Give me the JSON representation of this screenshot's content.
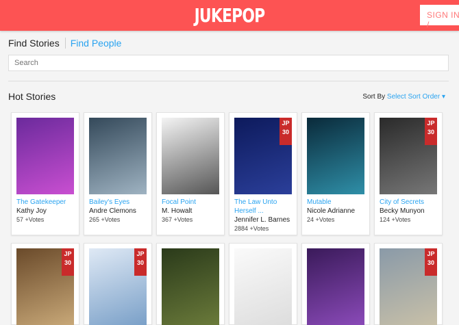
{
  "header": {
    "logo": "JUKEPOP",
    "signin_label": "SIGN IN /"
  },
  "tabs": [
    {
      "label": "Find Stories"
    },
    {
      "label": "Find People"
    }
  ],
  "search": {
    "placeholder": "Search"
  },
  "section": {
    "title": "Hot Stories",
    "sort_label": "Sort By",
    "sort_value": "Select Sort Order"
  },
  "stories": [
    {
      "title": "The Gatekeeper",
      "author": "Kathy Joy",
      "votes": "57 +Votes",
      "badge": "",
      "colors": [
        "#6b2a9c",
        "#c94fd1"
      ]
    },
    {
      "title": "Bailey's Eyes",
      "author": "Andre Clemons",
      "votes": "265 +Votes",
      "badge": "",
      "colors": [
        "#34495a",
        "#9fb3c2"
      ]
    },
    {
      "title": "Focal Point",
      "author": "M. Howalt",
      "votes": "367 +Votes",
      "badge": "",
      "colors": [
        "#f4f4f4",
        "#555"
      ]
    },
    {
      "title": "The Law Unto Herself ...",
      "author": "Jennifer L. Barnes",
      "votes": "2884 +Votes",
      "badge": "JP 30",
      "colors": [
        "#0d1a5c",
        "#2b3f9a"
      ]
    },
    {
      "title": "Mutable",
      "author": "Nicole Adrianne",
      "votes": "24 +Votes",
      "badge": "",
      "colors": [
        "#0a2a3a",
        "#2f8fa8"
      ]
    },
    {
      "title": "City of Secrets",
      "author": "Becky Munyon",
      "votes": "124 +Votes",
      "badge": "JP 30",
      "colors": [
        "#2a2a2a",
        "#777"
      ]
    }
  ],
  "stories_row2": [
    {
      "badge": "JP 30",
      "colors": [
        "#6a4a2a",
        "#c8a878"
      ]
    },
    {
      "badge": "JP 30",
      "colors": [
        "#dfe9f5",
        "#7aa0c8"
      ]
    },
    {
      "badge": "",
      "colors": [
        "#2a3a1a",
        "#6a7a3a"
      ]
    },
    {
      "badge": "",
      "colors": [
        "#fafafa",
        "#ddd"
      ]
    },
    {
      "badge": "",
      "colors": [
        "#3a1a5a",
        "#8a4ab8"
      ]
    },
    {
      "badge": "JP 30",
      "colors": [
        "#8a9aa8",
        "#c8c0a8"
      ]
    }
  ]
}
